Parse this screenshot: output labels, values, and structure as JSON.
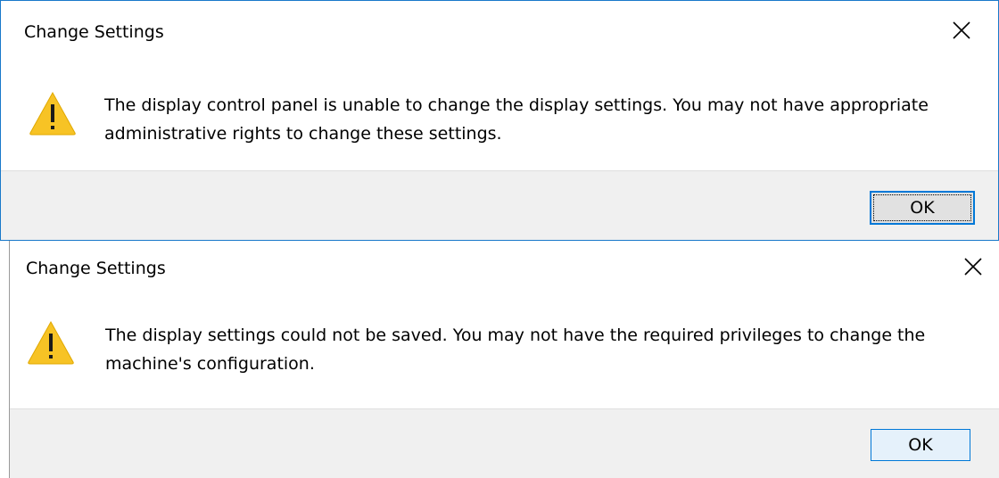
{
  "dialogs": [
    {
      "title": "Change Settings",
      "close_icon": "close-icon",
      "icon": "warning-icon",
      "message": "The display control panel is unable to change the display settings.  You may not have appropriate administrative rights to change these settings.",
      "ok_label": "OK",
      "focused": true
    },
    {
      "title": "Change Settings",
      "close_icon": "close-icon",
      "icon": "warning-icon",
      "message": "The display settings could not be saved.  You may not have the required privileges to change the machine's configuration.",
      "ok_label": "OK",
      "focused": false
    }
  ],
  "colors": {
    "accent_border": "#1979ca",
    "footer_bg": "#f0f0f0",
    "warning_fill": "#f7c325",
    "button_focus_border": "#0078d7"
  }
}
